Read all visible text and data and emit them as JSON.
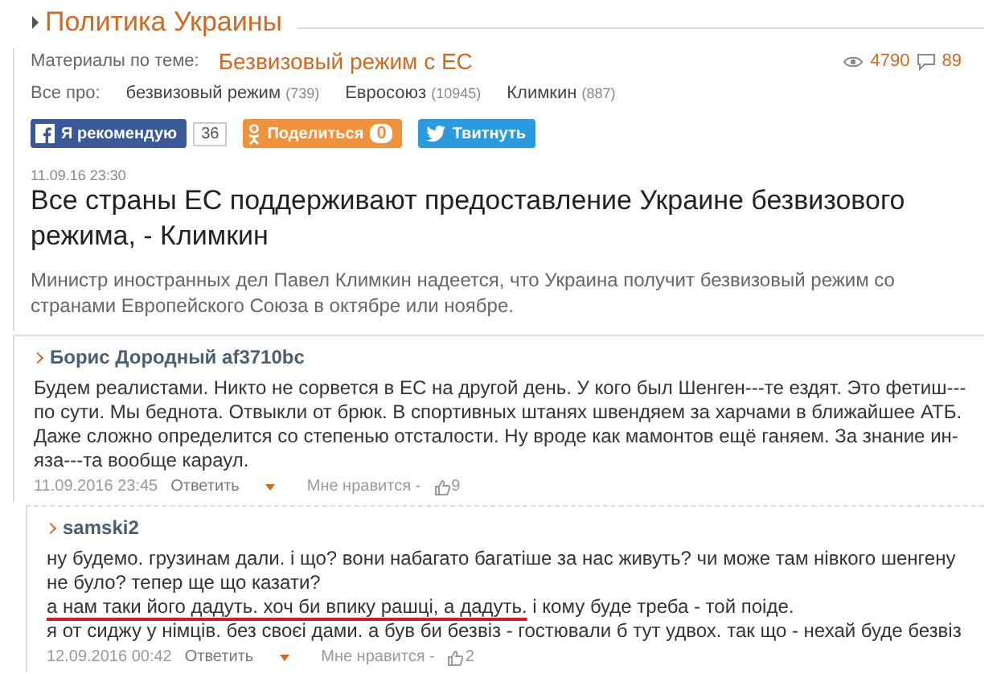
{
  "section": {
    "title": "Политика Украины"
  },
  "related": {
    "label": "Материалы по теме:",
    "link": "Безвизовый режим с ЕС"
  },
  "stats": {
    "views": "4790",
    "comments": "89"
  },
  "tags": {
    "label": "Все про:",
    "items": [
      {
        "name": "безвизовый режим",
        "count": "(739)"
      },
      {
        "name": "Евросоюз",
        "count": "(10945)"
      },
      {
        "name": "Климкин",
        "count": "(887)"
      }
    ]
  },
  "share": [
    {
      "kind": "facebook",
      "label": "Я рекомендую",
      "count": "36"
    },
    {
      "kind": "odnoklassniki",
      "label": "Поделиться",
      "count": "0"
    },
    {
      "kind": "twitter",
      "label": "Твитнуть"
    }
  ],
  "article": {
    "date": "11.09.16 23:30",
    "title": "Все страны ЕС поддерживают предоставление Украине безвизового режима, - Климкин",
    "lead": "Министр иностранных дел Павел Климкин надеется, что Украина получит безвизовый режим со странами Европейского Союза в октябре или ноябре."
  },
  "comments": [
    {
      "author": "Борис Дородный af3710bc",
      "reply": false,
      "segments": [
        {
          "text": "Будем реалистами. Никто не сорвется в ЕС на другой день. У кого был Шенген---те ездят. Это фетиш---по сути. Мы беднота. Отвыкли от брюк. В спортивных штанях швендяем за харчами в ближайшее АТБ. Даже сложно определится со степенью отсталости. Ну вроде как мамонтов ещё ганяем. За знание ин-яза---та вообще караул.",
          "underlined": false
        }
      ],
      "date": "11.09.2016 23:45",
      "reply_label": "Ответить",
      "like_label": "Мне нравится -",
      "likes": "9"
    },
    {
      "author": "samski2",
      "reply": true,
      "segments": [
        {
          "text": "ну будемо. грузинам дали. і що? вони набагато багатіше за нас живуть? чи може там нівкого шенгену не було? тепер ще що казати?\n",
          "underlined": false
        },
        {
          "text": "а нам таки його дадуть. хоч би впику рашці, а дадуть.",
          "underlined": true
        },
        {
          "text": " і кому буде треба - той поіде.\nя от сиджу у німців. без своєі дами. а був би безвіз - гостювали б тут удвох. так що - нехай буде безвіз",
          "underlined": false
        }
      ],
      "date": "12.09.2016 00:42",
      "reply_label": "Ответить",
      "like_label": "Мне нравится -",
      "likes": "2"
    }
  ]
}
